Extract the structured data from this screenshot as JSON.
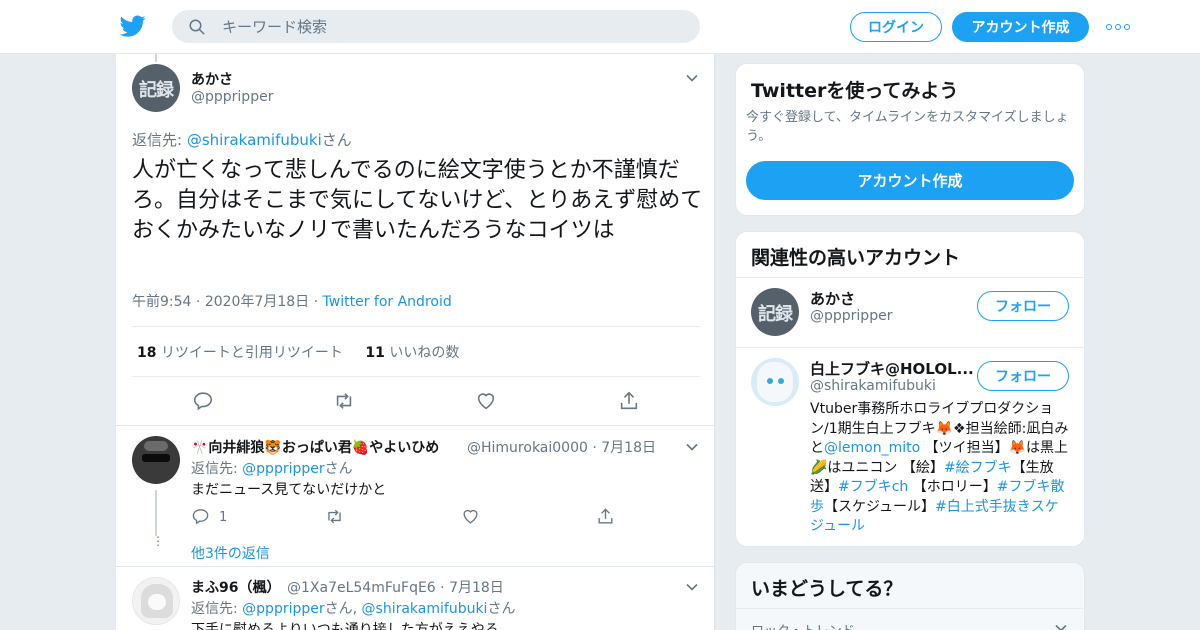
{
  "header": {
    "search_placeholder": "キーワード検索",
    "login_label": "ログイン",
    "signup_label": "アカウント作成"
  },
  "tweet": {
    "author_name": "あかさ",
    "author_handle": "@pppripper",
    "reply_to_prefix": "返信先: ",
    "reply_to_handle": "@shirakamifubuki",
    "reply_to_suffix": "さん",
    "text": "人が亡くなって悲しんでるのに絵文字使うとか不謹慎だろ。自分はそこまで気にしてないけど、とりあえず慰めておくかみたいなノリで書いたんだろうなコイツは",
    "time": "午前9:54",
    "date": "2020年7月18日",
    "source": "Twitter for Android",
    "retweet_count": "18",
    "retweet_label": "リツイートと引用リツイート",
    "like_count": "11",
    "like_label": "いいねの数",
    "avatar_text": "記録"
  },
  "replies": [
    {
      "name": "🎌向井緋狼🐯おっぱい君🍓やよいひめ",
      "handle": "@Himurokai0000",
      "date": "7月18日",
      "reply_to_prefix": "返信先: ",
      "reply_to_handle": "@pppripper",
      "reply_to_suffix": "さん",
      "text": "まだニュース見てないだけかと",
      "reply_count": "1",
      "more_replies": "他3件の返信"
    },
    {
      "name": "まふ96（楓）",
      "handle": "@1Xa7eL54mFuFqE6",
      "date": "7月18日",
      "reply_to_prefix": "返信先: ",
      "reply_to_handle1": "@pppripper",
      "reply_to_sep": "さん, ",
      "reply_to_handle2": "@shirakamifubuki",
      "reply_to_suffix": "さん",
      "text": "下手に慰めるよりいつも通り接した方がええやろ"
    }
  ],
  "sidebar": {
    "signup_card": {
      "title": "Twitterを使ってみよう",
      "subtitle": "今すぐ登録して、タイムラインをカスタマイズしましょう。",
      "button": "アカウント作成"
    },
    "related": {
      "title": "関連性の高いアカウント",
      "accounts": [
        {
          "name": "あかさ",
          "handle": "@pppripper",
          "follow": "フォロー"
        },
        {
          "name": "白上フブキ@HOLOL...",
          "handle": "@shirakamifubuki",
          "follow": "フォロー"
        }
      ],
      "bio_parts": [
        {
          "t": "Vtuber事務所ホロライブプロダクション/1期生白上フブキ🦊❖担当絵師:凪白みと",
          "link": false
        },
        {
          "t": "@lemon_mito",
          "link": true
        },
        {
          "t": " 【ツイ担当】🦊は黒上🌽はユニコン 【絵】",
          "link": false
        },
        {
          "t": "#絵フブキ",
          "link": true
        },
        {
          "t": "【生放送】",
          "link": false
        },
        {
          "t": "#フブキch",
          "link": true
        },
        {
          "t": " 【ホロリー】",
          "link": false
        },
        {
          "t": "#フブキ散歩",
          "link": true
        },
        {
          "t": "【スケジュール】",
          "link": false
        },
        {
          "t": "#白上式手抜きスケジュール",
          "link": true
        }
      ]
    },
    "trends": {
      "title": "いまどうしてる？",
      "first_label": "ロック・トレンド"
    }
  },
  "colors": {
    "accent": "#1da1f2",
    "link": "#1b95e0",
    "muted": "#657786",
    "bg": "#e6ecf0"
  }
}
